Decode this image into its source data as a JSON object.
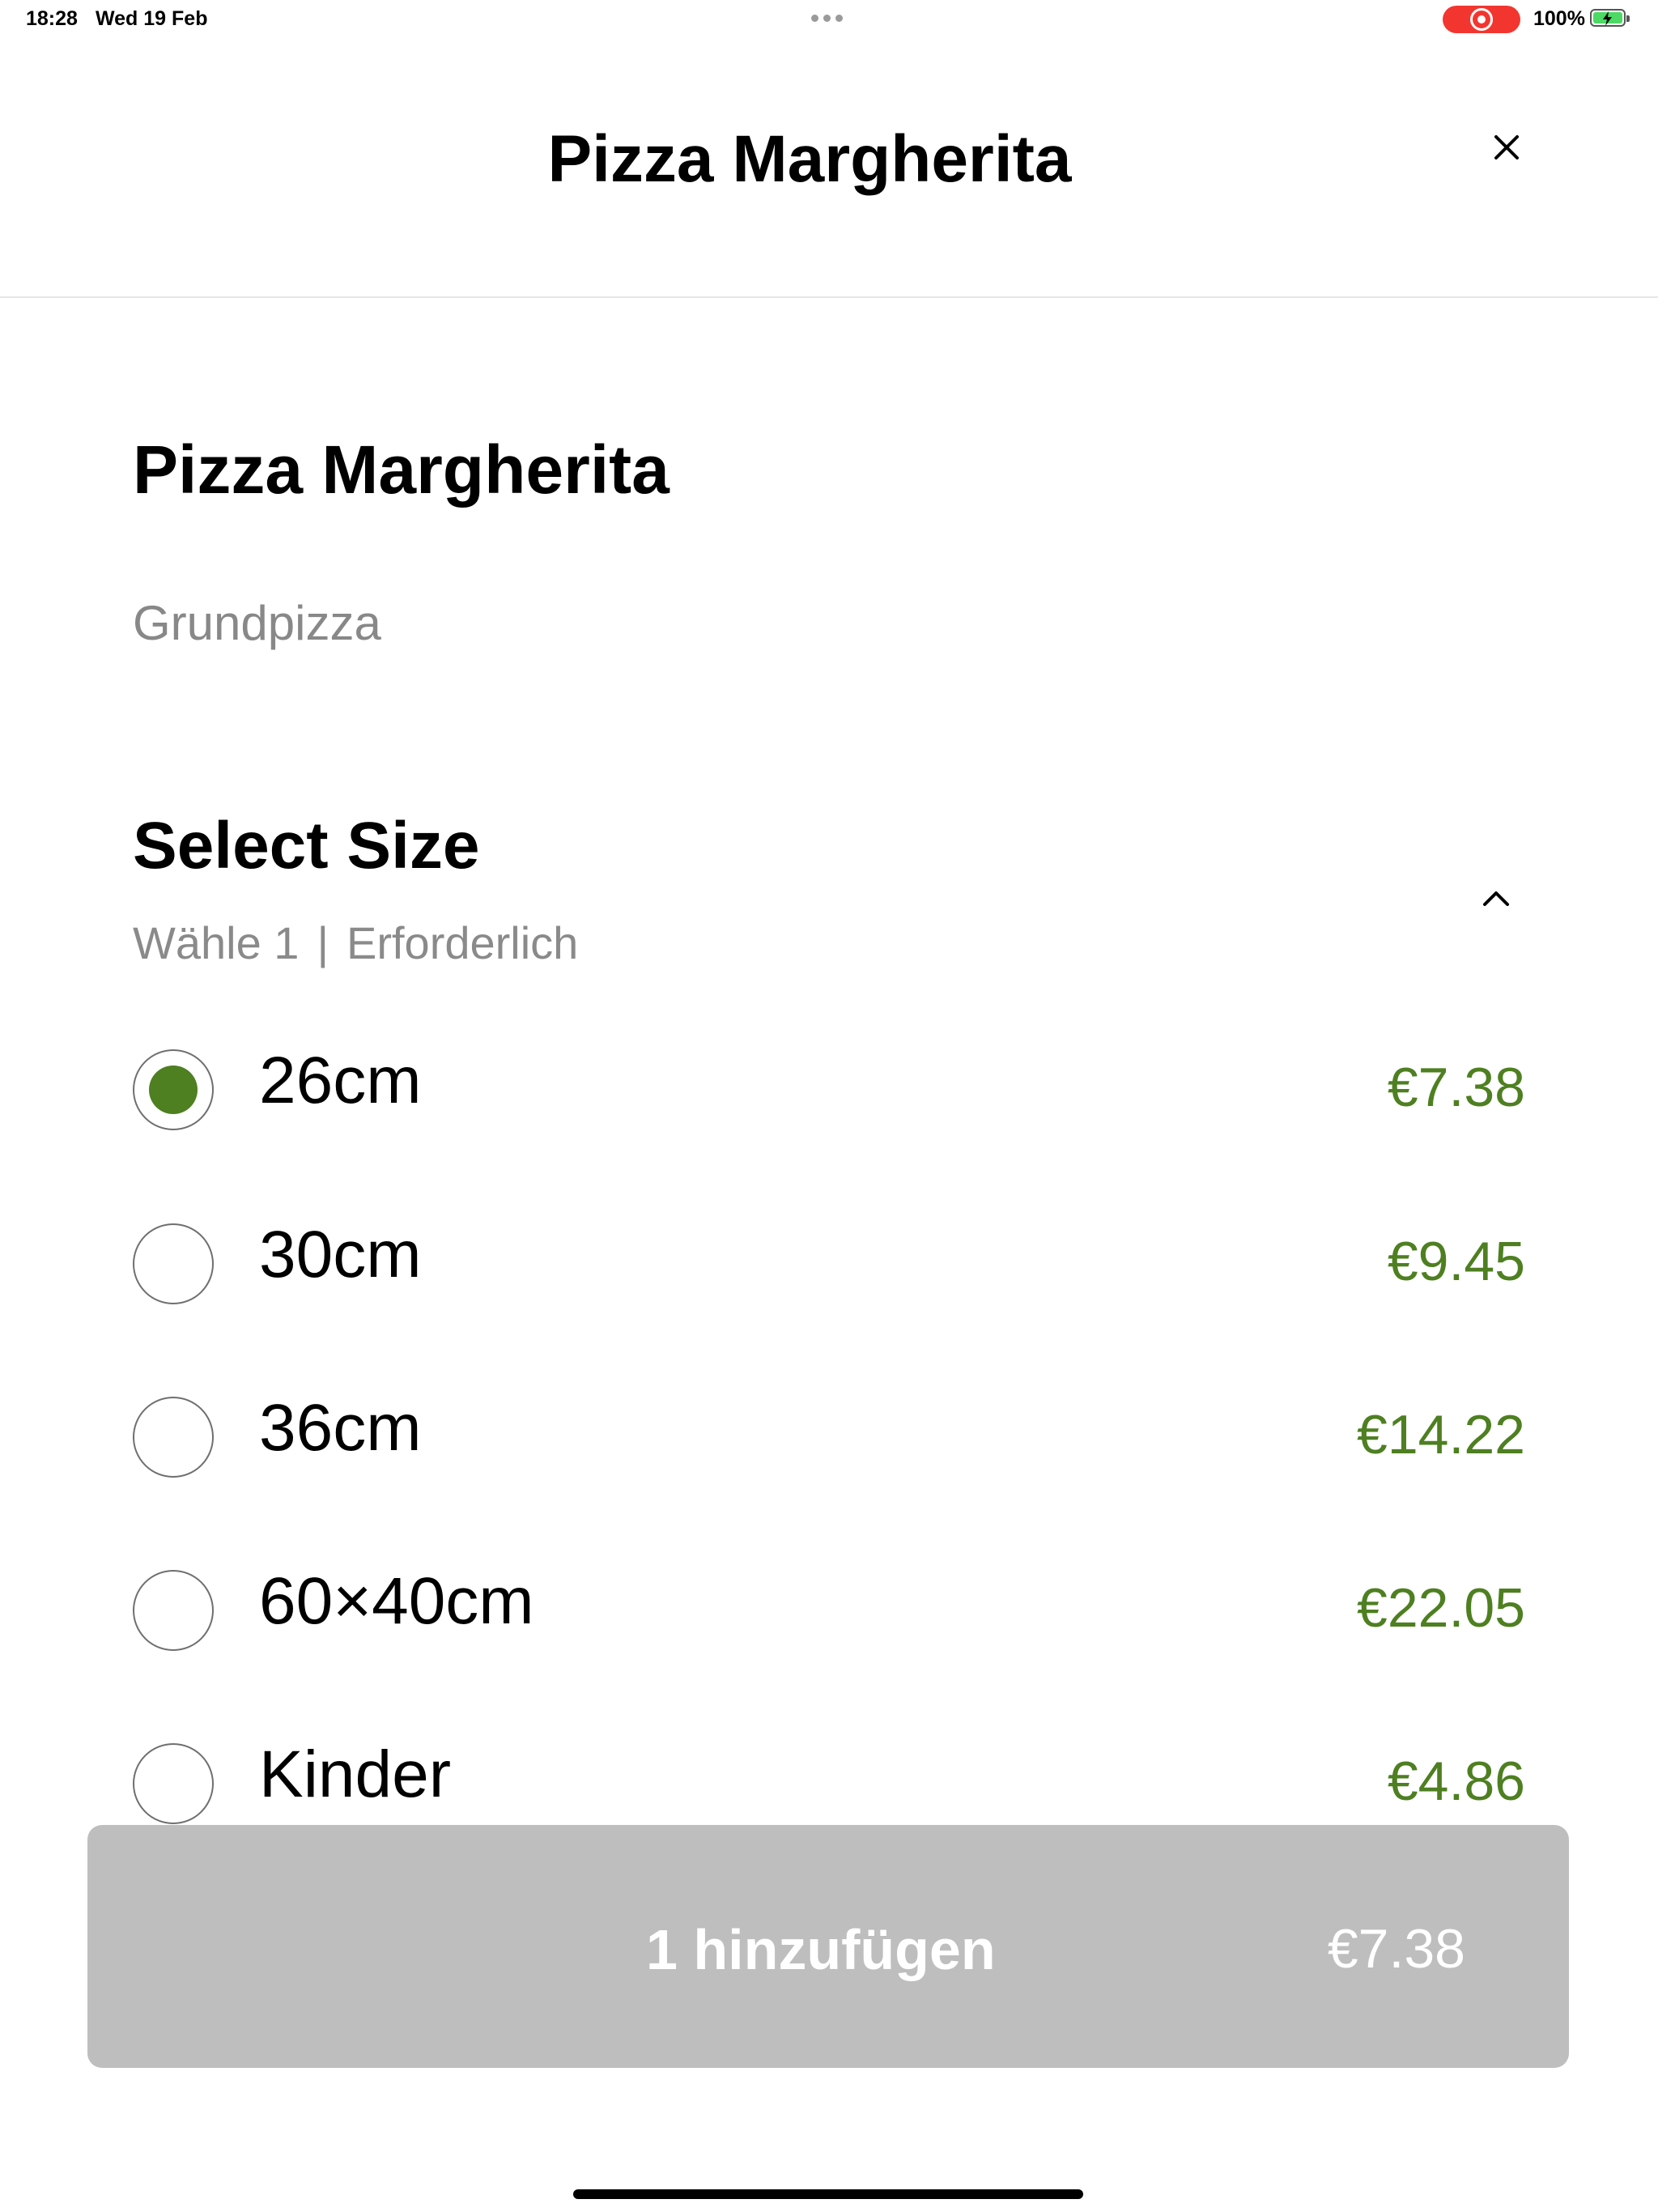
{
  "status_bar": {
    "time": "18:28",
    "date": "Wed 19 Feb",
    "battery_percent": "100%",
    "battery_level": 1.0,
    "recording_color": "#f2362f"
  },
  "header": {
    "title": "Pizza Margherita",
    "close_icon": "close-icon"
  },
  "product": {
    "name": "Pizza Margherita",
    "description": "Grundpizza"
  },
  "size_section": {
    "title": "Select Size",
    "choose_text": "Wähle 1",
    "separator": "|",
    "required_text": "Erforderlich",
    "collapse_icon": "chevron-up-icon",
    "options": [
      {
        "label": "26cm",
        "price": "€7.38",
        "selected": true
      },
      {
        "label": "30cm",
        "price": "€9.45",
        "selected": false
      },
      {
        "label": "36cm",
        "price": "€14.22",
        "selected": false
      },
      {
        "label": "60×40cm",
        "price": "€22.05",
        "selected": false
      },
      {
        "label": "Kinder",
        "price": "€4.86",
        "selected": false
      }
    ]
  },
  "add_button": {
    "label": "1 hinzufügen",
    "price": "€7.38"
  },
  "colors": {
    "accent_green": "#4e7f21",
    "button_disabled": "#bebebe",
    "muted_text": "#888888"
  }
}
